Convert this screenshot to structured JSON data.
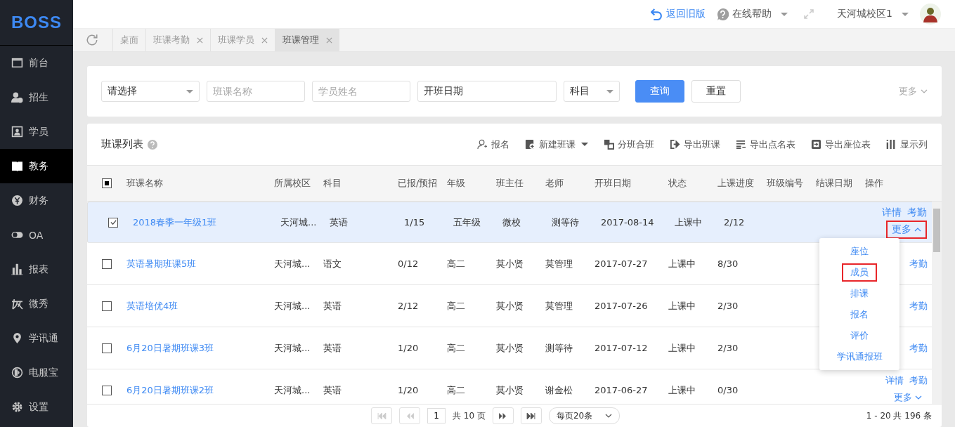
{
  "logo": "BOSS",
  "sidebar": [
    {
      "label": "前台",
      "selected": false
    },
    {
      "label": "招生",
      "selected": false
    },
    {
      "label": "学员",
      "selected": false
    },
    {
      "label": "教务",
      "selected": true
    },
    {
      "label": "财务",
      "selected": false
    },
    {
      "label": "OA",
      "selected": false
    },
    {
      "label": "报表",
      "selected": false
    },
    {
      "label": "微秀",
      "selected": false
    },
    {
      "label": "学讯通",
      "selected": false
    },
    {
      "label": "电服宝",
      "selected": false
    },
    {
      "label": "设置",
      "selected": false
    }
  ],
  "header": {
    "back_link": "返回旧版",
    "help": "在线帮助",
    "user": "天河城校区1"
  },
  "tabs": [
    {
      "label": "桌面",
      "selected": false,
      "closable": false
    },
    {
      "label": "班课考勤",
      "selected": false,
      "closable": true
    },
    {
      "label": "班课学员",
      "selected": false,
      "closable": true
    },
    {
      "label": "班课管理",
      "selected": true,
      "closable": true
    }
  ],
  "filters": {
    "campus_select": "请选择",
    "class_name_placeholder": "班课名称",
    "student_placeholder": "学员姓名",
    "date_value": "开班日期",
    "subject_select": "科目",
    "query_button": "查询",
    "reset_button": "重置",
    "more": "更多"
  },
  "table_title": "班课列表",
  "toolbar": [
    {
      "label": "报名",
      "dropdown": false
    },
    {
      "label": "新建班课",
      "dropdown": true
    },
    {
      "label": "分班合班",
      "dropdown": false
    },
    {
      "label": "导出班课",
      "dropdown": false
    },
    {
      "label": "导出点名表",
      "dropdown": false
    },
    {
      "label": "导出座位表",
      "dropdown": false
    },
    {
      "label": "显示列",
      "dropdown": false
    }
  ],
  "select_all_partial": true,
  "columns": [
    "班课名称",
    "所属校区",
    "科目",
    "已报/预招",
    "年级",
    "班主任",
    "老师",
    "开班日期",
    "状态",
    "上课进度",
    "班级编号",
    "结课日期",
    "操作"
  ],
  "rows": [
    {
      "checked": true,
      "selected": true,
      "cells": [
        "2018春季一年级1班",
        "天河城...",
        "英语",
        "1/15",
        "五年级",
        "微校",
        "测等待",
        "2017-08-14",
        "上课中",
        "2/12"
      ],
      "actions": [
        "详情",
        "考勤"
      ],
      "more": "更多",
      "more_open": true,
      "more_highlighted": true
    },
    {
      "checked": false,
      "selected": false,
      "cells": [
        "英语暑期班课5班",
        "天河城...",
        "语文",
        "0/12",
        "高二",
        "莫小贤",
        "莫管理",
        "2017-07-27",
        "上课中",
        "8/30"
      ],
      "actions": [
        "考勤"
      ]
    },
    {
      "checked": false,
      "selected": false,
      "cells": [
        "英语培优4班",
        "天河城...",
        "英语",
        "2/12",
        "高二",
        "莫小贤",
        "莫管理",
        "2017-07-26",
        "上课中",
        "2/30"
      ],
      "actions": [
        "考勤"
      ]
    },
    {
      "checked": false,
      "selected": false,
      "cells": [
        "6月20日暑期班课3班",
        "天河城...",
        "英语",
        "1/20",
        "高二",
        "莫小贤",
        "测等待",
        "2017-07-12",
        "上课中",
        "2/30"
      ],
      "actions": [
        "考勤"
      ]
    },
    {
      "checked": false,
      "selected": false,
      "cells": [
        "6月20日暑期班课2班",
        "天河城...",
        "英语",
        "1/20",
        "高二",
        "莫小贤",
        "谢金松",
        "2017-06-27",
        "上课中",
        "0/30"
      ],
      "actions": [
        "详情",
        "考勤"
      ],
      "more": "更多",
      "more_open": false,
      "more_highlighted": false
    }
  ],
  "more_menu": [
    {
      "label": "座位",
      "highlighted": false
    },
    {
      "label": "成员",
      "highlighted": true
    },
    {
      "label": "排课",
      "highlighted": false
    },
    {
      "label": "报名",
      "highlighted": false
    },
    {
      "label": "评价",
      "highlighted": false
    },
    {
      "label": "学讯通报班",
      "highlighted": false
    }
  ],
  "pagination": {
    "page": "1",
    "total_pages": "共 10 页",
    "per_page": "每页20条",
    "range": "1 - 20 共 196 条"
  }
}
